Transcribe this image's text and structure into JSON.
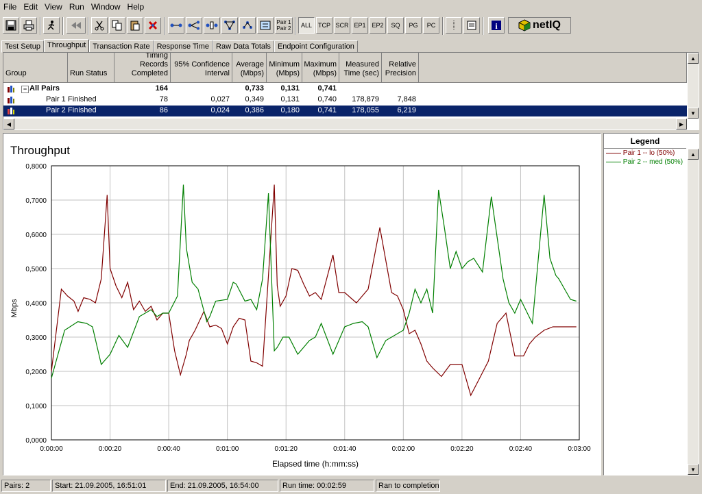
{
  "menu": [
    "File",
    "Edit",
    "View",
    "Run",
    "Window",
    "Help"
  ],
  "toolbar": {
    "pair_label_1": "Pair 1",
    "pair_label_2": "Pair 2",
    "protocols": [
      "ALL",
      "TCP",
      "SCR",
      "EP1",
      "EP2",
      "SQ",
      "PG",
      "PC"
    ],
    "logo_text": "netIQ"
  },
  "tabs": [
    "Test Setup",
    "Throughput",
    "Transaction Rate",
    "Response Time",
    "Raw Data Totals",
    "Endpoint Configuration"
  ],
  "grid": {
    "headers": [
      "Group",
      "Run Status",
      "Timing Records Completed",
      "95% Confidence Interval",
      "Average (Mbps)",
      "Minimum (Mbps)",
      "Maximum (Mbps)",
      "Measured Time (sec)",
      "Relative Precision"
    ],
    "rows": [
      {
        "name": "All Pairs",
        "status": "",
        "records": "164",
        "ci": "",
        "avg": "0,733",
        "min": "0,131",
        "max": "0,741",
        "time": "",
        "prec": ""
      },
      {
        "name": "Pair 1",
        "status": "Finished",
        "records": "78",
        "ci": "0,027",
        "avg": "0,349",
        "min": "0,131",
        "max": "0,740",
        "time": "178,879",
        "prec": "7,848"
      },
      {
        "name": "Pair 2",
        "status": "Finished",
        "records": "86",
        "ci": "0,024",
        "avg": "0,386",
        "min": "0,180",
        "max": "0,741",
        "time": "178,055",
        "prec": "6,219"
      }
    ]
  },
  "legend": {
    "title": "Legend",
    "items": [
      {
        "label": "Pair 1 -- lo (50%)",
        "color": "#800000"
      },
      {
        "label": "Pair 2 -- med (50%)",
        "color": "#007f00"
      }
    ]
  },
  "status": {
    "pairs": "Pairs: 2",
    "start": "Start: 21.09.2005, 16:51:01",
    "end": "End: 21.09.2005, 16:54:00",
    "runtime": "Run time: 00:02:59",
    "result": "Ran to completion"
  },
  "chart_data": {
    "type": "line",
    "title": "Throughput",
    "xlabel": "Elapsed time (h:mm:ss)",
    "ylabel": "Mbps",
    "xlim": [
      0,
      180
    ],
    "ylim": [
      0,
      0.8
    ],
    "yticks": [
      "0,0000",
      "0,1000",
      "0,2000",
      "0,3000",
      "0,4000",
      "0,5000",
      "0,6000",
      "0,7000",
      "0,8000"
    ],
    "xticks": [
      "0:00:00",
      "0:00:20",
      "0:00:40",
      "0:01:00",
      "0:01:20",
      "0:01:40",
      "0:02:00",
      "0:02:20",
      "0:02:40",
      "0:03:00"
    ],
    "grid": true,
    "series": [
      {
        "name": "Pair 1 -- lo (50%)",
        "color": "#800000",
        "x": [
          0,
          3.4,
          5.5,
          7.7,
          9.1,
          11,
          13.2,
          15,
          17,
          19,
          20,
          22,
          24,
          26,
          28,
          30,
          32,
          34,
          36,
          38,
          40,
          42,
          44,
          46,
          47,
          49,
          52,
          54,
          56,
          58,
          60,
          62,
          64,
          66,
          68,
          70,
          72,
          74,
          76,
          77,
          78,
          80,
          82,
          84,
          86,
          88,
          90,
          92,
          96,
          98,
          100,
          102,
          104,
          108,
          112,
          116,
          118,
          120,
          122,
          124,
          126,
          128,
          130,
          133,
          136,
          140,
          143,
          146,
          149,
          152,
          155,
          158,
          161,
          163,
          165,
          168,
          171,
          174,
          176,
          179
        ],
        "y": [
          0.2,
          0.44,
          0.42,
          0.405,
          0.375,
          0.415,
          0.41,
          0.4,
          0.47,
          0.715,
          0.5,
          0.45,
          0.415,
          0.46,
          0.38,
          0.405,
          0.375,
          0.39,
          0.35,
          0.37,
          0.37,
          0.26,
          0.19,
          0.25,
          0.29,
          0.32,
          0.375,
          0.33,
          0.335,
          0.325,
          0.28,
          0.33,
          0.355,
          0.35,
          0.23,
          0.225,
          0.215,
          0.48,
          0.745,
          0.45,
          0.39,
          0.42,
          0.5,
          0.495,
          0.455,
          0.42,
          0.43,
          0.41,
          0.54,
          0.43,
          0.43,
          0.415,
          0.4,
          0.44,
          0.62,
          0.43,
          0.42,
          0.38,
          0.31,
          0.32,
          0.28,
          0.23,
          0.21,
          0.185,
          0.22,
          0.22,
          0.13,
          0.18,
          0.23,
          0.34,
          0.37,
          0.245,
          0.245,
          0.28,
          0.3,
          0.32,
          0.33,
          0.33,
          0.33,
          0.33
        ]
      },
      {
        "name": "Pair 2 -- med (50%)",
        "color": "#007f00",
        "x": [
          0,
          4.5,
          9,
          12,
          14,
          17,
          20,
          23,
          26,
          30,
          32,
          34,
          36,
          38,
          40,
          43,
          45,
          46,
          48,
          50,
          53,
          54,
          56,
          60,
          62,
          63,
          66,
          68,
          70,
          72,
          74,
          76,
          77,
          79,
          81,
          84,
          86,
          88,
          90,
          92,
          96,
          100,
          103,
          106,
          108,
          111,
          114,
          116,
          120,
          122,
          124,
          126,
          128,
          130,
          132,
          134,
          136,
          138,
          140,
          142,
          144,
          147,
          150,
          154,
          156,
          158,
          160,
          164,
          168,
          170,
          172,
          173,
          175,
          177,
          179
        ],
        "y": [
          0.18,
          0.32,
          0.345,
          0.34,
          0.33,
          0.22,
          0.25,
          0.305,
          0.27,
          0.36,
          0.37,
          0.38,
          0.36,
          0.37,
          0.37,
          0.42,
          0.745,
          0.56,
          0.46,
          0.44,
          0.345,
          0.36,
          0.405,
          0.41,
          0.46,
          0.455,
          0.405,
          0.41,
          0.38,
          0.47,
          0.72,
          0.26,
          0.27,
          0.3,
          0.3,
          0.25,
          0.27,
          0.29,
          0.3,
          0.34,
          0.25,
          0.33,
          0.34,
          0.345,
          0.33,
          0.24,
          0.29,
          0.3,
          0.32,
          0.37,
          0.44,
          0.4,
          0.44,
          0.37,
          0.73,
          0.62,
          0.5,
          0.55,
          0.5,
          0.52,
          0.53,
          0.49,
          0.71,
          0.47,
          0.4,
          0.37,
          0.41,
          0.34,
          0.715,
          0.53,
          0.48,
          0.47,
          0.44,
          0.41,
          0.405
        ]
      }
    ]
  }
}
